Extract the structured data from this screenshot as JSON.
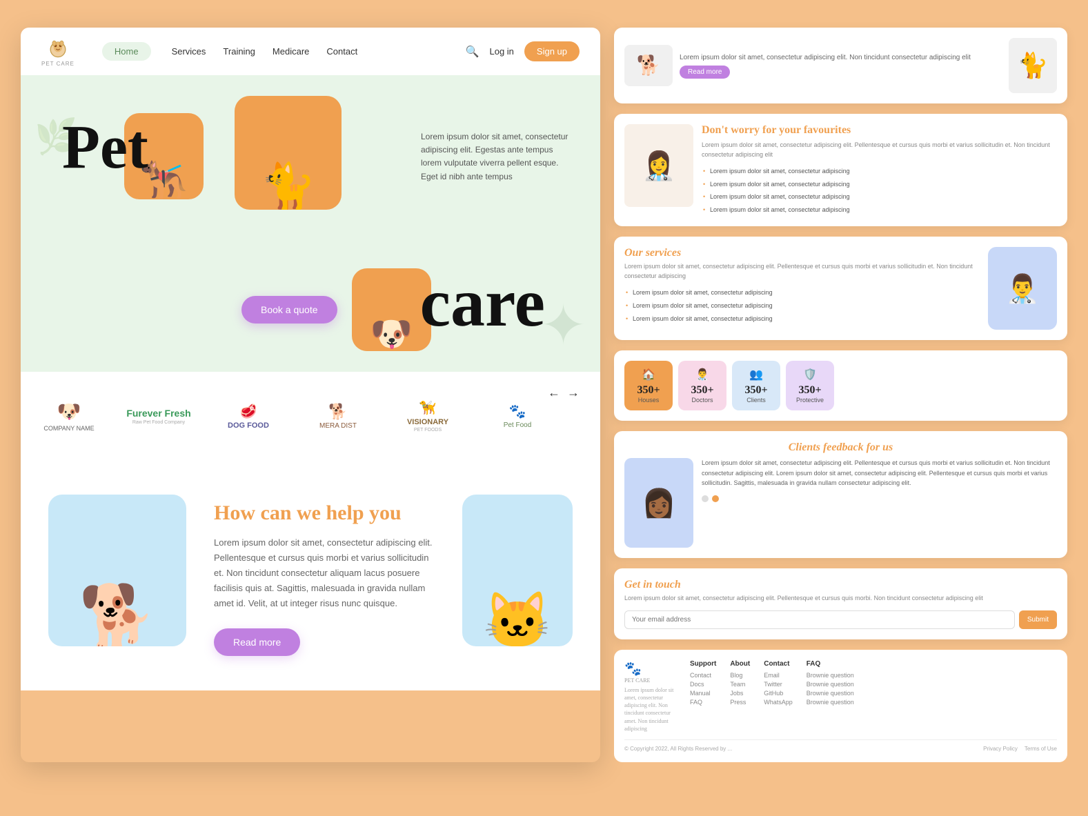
{
  "site": {
    "name": "PET CARE",
    "logo_emoji": "🐾"
  },
  "navbar": {
    "home_label": "Home",
    "links": [
      "Services",
      "Training",
      "Medicare",
      "Contact"
    ],
    "login_label": "Log in",
    "signup_label": "Sign up"
  },
  "hero": {
    "title_pet": "Pet",
    "title_care": "care",
    "description": "Lorem ipsum dolor sit amet, consectetur adipiscing elit. Egestas ante tempus lorem vulputate viverra pellent esque. Eget id nibh ante tempus",
    "book_btn": "Book a quote"
  },
  "brands": {
    "prev_arrow": "←",
    "next_arrow": "→",
    "companies": [
      {
        "name": "COMPANY NAME",
        "icon": "🐶",
        "sub": ""
      },
      {
        "name": "Furever Fresh",
        "icon": "🌿",
        "sub": "Raw Pet Food Company"
      },
      {
        "name": "DOG FOOD",
        "icon": "🍖",
        "sub": ""
      },
      {
        "name": "MERA DIST",
        "icon": "🐕",
        "sub": ""
      },
      {
        "name": "VISIONARY",
        "icon": "🦮",
        "sub": "PET FOODS"
      },
      {
        "name": "Pet Food",
        "icon": "🐾",
        "sub": ""
      }
    ]
  },
  "help_section": {
    "title_pre": "How can we",
    "title_highlight": "help",
    "title_post": "you",
    "description": "Lorem ipsum dolor sit amet, consectetur adipiscing elit. Pellentesque et cursus quis morbi et varius sollicitudin et. Non tincidunt consectetur aliquam lacus posuere facilisis quis at. Sagittis, malesuada in gravida nullam amet id. Velit, at ut integer risus nunc quisque.",
    "read_more_btn": "Read more"
  },
  "dont_worry": {
    "title_pre": "Don't",
    "title_highlight": "worry",
    "title_post": "for your favourites",
    "description": "Lorem ipsum dolor sit amet, consectetur adipiscing elit. Pellentesque et cursus quis morbi et varius sollicitudin et. Non tincidunt consectetur adipiscing elit",
    "bullets": [
      "Lorem ipsum dolor sit amet, consectetur adipiscing",
      "Lorem ipsum dolor sit amet, consectetur adipiscing",
      "Lorem ipsum dolor sit amet, consectetur adipiscing",
      "Lorem ipsum dolor sit amet, consectetur adipiscing"
    ]
  },
  "our_services": {
    "title_pre": "Our",
    "title_highlight": "services",
    "description": "Lorem ipsum dolor sit amet, consectetur adipiscing elit. Pellentesque et cursus quis morbi et varius sollicitudin et. Non tincidunt consectetur adipiscing",
    "bullets": [
      "Lorem ipsum dolor sit amet, consectetur adipiscing",
      "Lorem ipsum dolor sit amet, consectetur adipiscing",
      "Lorem ipsum dolor sit amet, consectetur adipiscing"
    ]
  },
  "stats": [
    {
      "number": "350+",
      "label": "Houses",
      "icon": "🏠",
      "color": "orange"
    },
    {
      "number": "350+",
      "label": "Doctors",
      "icon": "👨‍⚕️",
      "color": "pink"
    },
    {
      "number": "350+",
      "label": "Clients",
      "icon": "👥",
      "color": "blue"
    },
    {
      "number": "350+",
      "label": "Protective",
      "icon": "🛡️",
      "color": "purple"
    }
  ],
  "feedback": {
    "title_pre": "Clients",
    "title_highlight": "feedback",
    "title_post": "for us",
    "description": "Lorem ipsum dolor sit amet, consectetur adipiscing elit. Pellentesque et cursus quis morbi et varius sollicitudin et. Non tincidunt consectetur adipiscing elit. Lorem ipsum dolor sit amet, consectetur adipiscing elit. Pellentesque et cursus quis morbi et varius sollicitudin. Sagittis, malesuada in gravida nullam consectetur adipiscing elit.",
    "dot_active": 1,
    "dot_count": 2
  },
  "get_in_touch": {
    "title_pre": "Get in",
    "title_highlight": "touch",
    "description": "Lorem ipsum dolor sit amet, consectetur adipiscing elit. Pellentesque et cursus quis morbi. Non tincidunt consectetur adipiscing elit",
    "input_placeholder": "Your email address",
    "submit_label": "Submit"
  },
  "footer": {
    "logo_text": "PET CARE",
    "description": "Lorem ipsum dolor sit amet, consectetur adipiscing elit. Non tincidunt consectetur amet. Non tincidunt adipiscing",
    "columns": [
      {
        "title": "Support",
        "items": [
          "Contact",
          "Docs",
          "Manual",
          "FAQ"
        ]
      },
      {
        "title": "About",
        "items": [
          "Blog",
          "Team",
          "Jobs",
          "Press"
        ]
      },
      {
        "title": "Contact",
        "items": [
          "Email",
          "Twitter",
          "GitHub",
          "WhatsApp"
        ]
      },
      {
        "title": "FAQ",
        "items": [
          "Brownie question",
          "Brownie question",
          "Brownie question",
          "Brownie question"
        ]
      }
    ],
    "copyright": "© Copyright 2022, All Rights Reserved by ...",
    "bottom_links": [
      "Privacy Policy",
      "Terms of Use"
    ]
  },
  "top_preview": {
    "description": "Lorem ipsum dolor sit amet, consectetur adipiscing elit. Non tincidunt consectetur adipiscing elit",
    "read_more": "Read more"
  }
}
